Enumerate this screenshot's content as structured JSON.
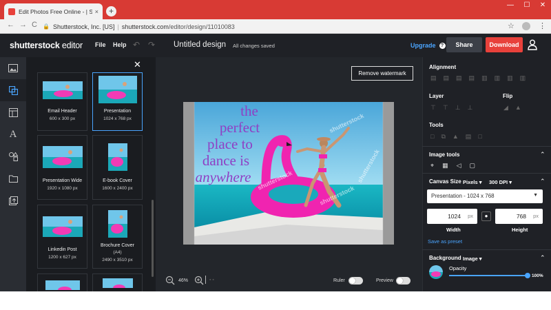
{
  "browser": {
    "tab_title": "Edit Photos Free Online - | Shutte",
    "tab_close": "×",
    "new_tab": "+",
    "win_min": "—",
    "win_max": "☐",
    "win_close": "✕",
    "back": "←",
    "forward": "→",
    "reload": "C",
    "site": "Shutterstock, Inc. [US]",
    "url_domain": "shutterstock.com",
    "url_path": "/editor/design/11010083",
    "star": "☆",
    "menu": "⋮"
  },
  "header": {
    "logo_main": "shutterstock",
    "logo_suffix": " editor",
    "menu_file": "File",
    "menu_help": "Help",
    "undo": "↶",
    "redo": "↷",
    "doc_title": "Untitled design",
    "save_status": "All changes saved",
    "upgrade": "Upgrade",
    "upgrade_info": "?",
    "share": "Share",
    "download": "Download"
  },
  "left_panel": {
    "close": "✕",
    "templates": [
      {
        "name": "Email Header",
        "size": "600 x 300 px"
      },
      {
        "name": "Presentation",
        "size": "1024 x 768 px"
      },
      {
        "name": "Presentation Wide",
        "size": "1920 x 1080 px"
      },
      {
        "name": "E-book Cover",
        "size": "1600 x 2400 px"
      },
      {
        "name": "Linkedin Post",
        "size": "1200 x 627 px"
      },
      {
        "name": "Brochure Cover",
        "size": "(A4)"
      },
      {
        "name": "",
        "size": "2490 x 3510 px"
      }
    ]
  },
  "workspace": {
    "remove_watermark": "Remove watermark",
    "canvas_text": [
      "the",
      "perfect",
      "place to",
      "dance is",
      "anywhere"
    ],
    "watermark": "shutterstock",
    "zoom_value": "46%",
    "ruler_label": "Ruler",
    "preview_label": "Preview"
  },
  "right_panel": {
    "alignment": "Alignment",
    "layer": "Layer",
    "flip": "Flip",
    "tools": "Tools",
    "image_tools": "Image tools",
    "canvas_size": "Canvas Size",
    "units": "Pixels",
    "dpi_value": "300",
    "dpi_label": "DPI",
    "preset": "Presentation - 1024 x 768",
    "width_value": "1024",
    "height_value": "768",
    "unit_px": "px",
    "width_label": "Width",
    "height_label": "Height",
    "save_preset": "Save as preset",
    "background": "Background",
    "background_type": "Image",
    "opacity_label": "Opacity",
    "opacity_value": "100%",
    "opacity": 1.0
  },
  "colors": {
    "accent": "#4aa5ff",
    "download": "#e8413b",
    "browser_bar": "#d83a34",
    "canvas_text": "#8f3fc4"
  }
}
